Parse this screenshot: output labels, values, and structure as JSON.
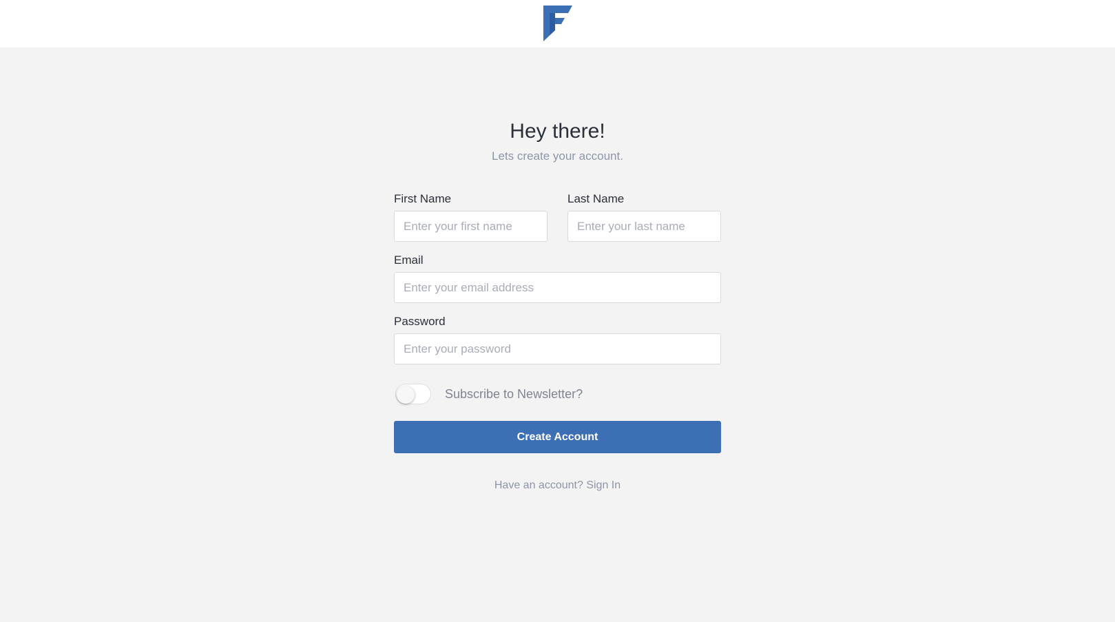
{
  "brand": {
    "logo_icon": "brand-f-logo",
    "accent_color": "#3d6fb4"
  },
  "header": {
    "title": "Hey there!",
    "subtitle": "Lets create your account."
  },
  "form": {
    "first_name": {
      "label": "First Name",
      "placeholder": "Enter your first name",
      "value": ""
    },
    "last_name": {
      "label": "Last Name",
      "placeholder": "Enter your last name",
      "value": ""
    },
    "email": {
      "label": "Email",
      "placeholder": "Enter your email address",
      "value": ""
    },
    "password": {
      "label": "Password",
      "placeholder": "Enter your password",
      "value": ""
    },
    "newsletter": {
      "label": "Subscribe to Newsletter?",
      "checked": false
    },
    "submit_label": "Create Account"
  },
  "footer": {
    "prompt": "Have an account?",
    "link_label": "Sign In"
  }
}
